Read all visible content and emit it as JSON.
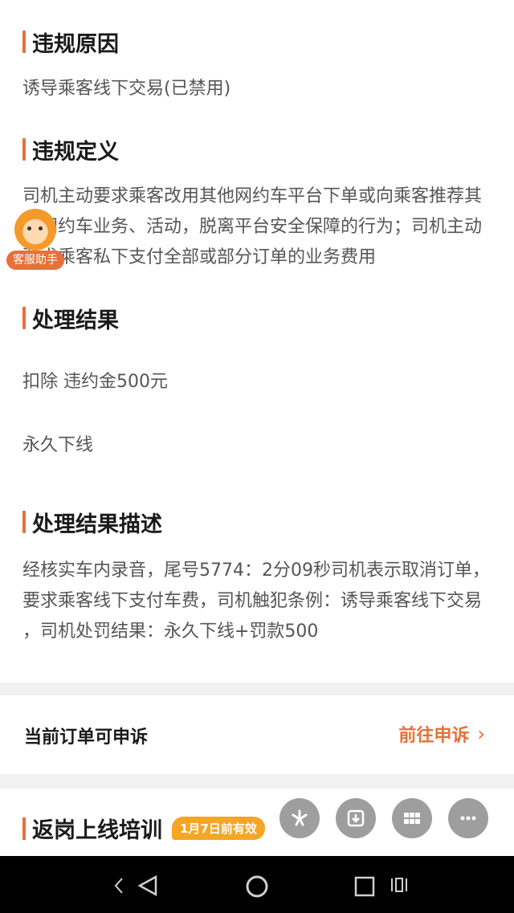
{
  "sections": [
    {
      "title": "违规原因",
      "text": "诱导乘客线下交易(已禁用)"
    },
    {
      "title": "违规定义",
      "text": "司机主动要求乘客改用其他网约车平台下单或向乘客推荐其他网约车业务、活动，脱离平台安全保障的行为；司机主动要求乘客私下支付全部或部分订单的业务费用"
    },
    {
      "title": "处理结果",
      "items": [
        "扣除 违约金500元",
        "永久下线"
      ]
    },
    {
      "title": "处理结果描述",
      "text": "经核实车内录音，尾号5774：2分09秒司机表示取消订单，要求乘客线下支付车费，司机触犯条例：诱导乘客线下交易 ，司机处罚结果：永久下线+罚款500"
    }
  ],
  "appeal": {
    "label": "当前订单可申诉",
    "action": "前往申诉"
  },
  "training": {
    "title": "返岗上线培训",
    "badge": "1月7日前有效"
  },
  "assistant": {
    "label": "客服助手"
  },
  "fabs": [
    "sparkle-icon",
    "download-icon",
    "grid-icon",
    "more-icon"
  ],
  "navbar": [
    "back-icon",
    "home-icon",
    "recents-icon",
    "menu-icon"
  ],
  "colors": {
    "accent": "#e8703a",
    "badge": "#f5a623"
  }
}
